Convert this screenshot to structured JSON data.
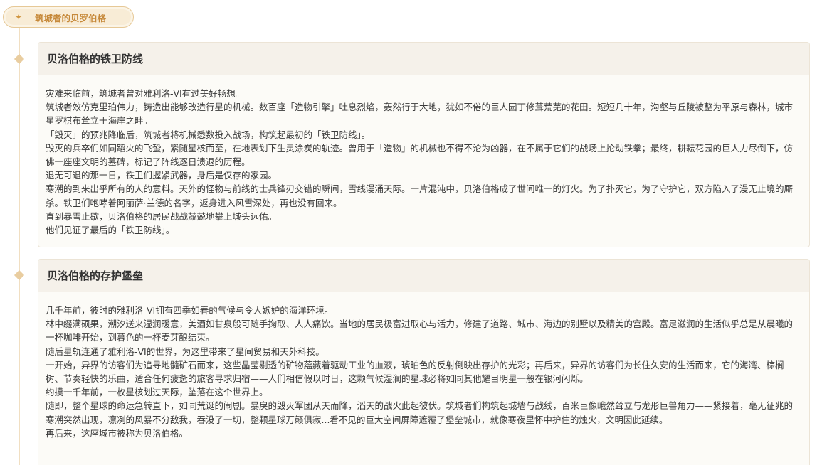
{
  "header_tag": {
    "icon": "sparkle-icon",
    "label": "筑城者的贝罗伯格"
  },
  "sections": [
    {
      "title": "贝洛伯格的铁卫防线",
      "paragraphs": [
        "灾难来临前，筑城者曾对雅利洛-VI有过美好畅想。",
        "筑城者效仿克里珀伟力，铸造出能够改造行星的机械。数百座「造物引擎」吐息烈焰，轰然行于大地，犹如不倦的巨人园丁修葺荒芜的花田。短短几十年，沟壑与丘陵被整为平原与森林，城市星罗棋布耸立于海岸之畔。",
        "「毁灭」的预兆降临后，筑城者将机械悉数投入战场，构筑起最初的「铁卫防线」。",
        "毁灭的兵卒们如同蹈火的飞蛩，紧随星核而至，在地表划下生灵涂炭的轨迹。曾用于「造物」的机械也不得不沦为凶器，在不属于它们的战场上抡动铁拳；最终，耕耘花园的巨人力尽倒下，仿佛一座座文明的墓碑，标记了阵线逐日溃退的历程。",
        "退无可退的那一日，铁卫们握紧武器，身后是仅存的家园。",
        "寒潮的到来出乎所有的人的意料。天外的怪物与前线的士兵锋刃交错的瞬间，雪线漫涌天际。一片混沌中，贝洛伯格成了世间唯一的灯火。为了扑灭它，为了守护它，双方陷入了漫无止境的厮杀。铁卫们咆哮着阿丽萨·兰德的名字，返身进入风雪深处，再也没有回来。",
        "直到暴雪止歇，贝洛伯格的居民战战兢兢地攀上城头远佑。",
        "他们见证了最后的「铁卫防线」。"
      ]
    },
    {
      "title": "贝洛伯格的存护堡垒",
      "paragraphs": [
        "几千年前，彼时的雅利洛-VI拥有四季如春的气候与令人嫉妒的海洋环境。",
        "林中缀满硕果，潮汐送来湿润暖意，美酒如甘泉般可随手掬取、人人痛饮。当地的居民极富进取心与活力，修建了道路、城市、海边的别墅以及精美的宫殿。富足滋润的生活似乎总是从晨曦的一杯咖啡开始，到暮色的一杯麦芽酿结束。",
        "随后星轨连通了雅利洛-VI的世界，为这里带来了星间贸易和天外科技。",
        "一开始，异界的访客们为追寻地髓矿石而来，这些晶莹剔透的矿物蕴藏着驱动工业的血液，琥珀色的反射倒映出存护的光彩；再后来，异界的访客们为长住久安的生活而来，它的海湾、棕榈树、节奏轻快的乐曲，适合任何疲惫的旅客寻求归宿——人们相信假以时日，这颗气候湿润的星球必将如同其他耀目明星一般在银河闪烁。",
        "约摸一千年前，一枚星核划过天际，坠落在这个世界上。",
        "随即，整个星球的命运急转直下，如同荒诞的闹剧。暴戾的毁灭军团从天而降，滔天的战火此起彼伏。筑城者们构筑起城墙与战线，百米巨像峨然耸立与龙形巨兽角力——紧接着，毫无征兆的寒潮突然出现，凛冽的风暴不分敌我，吞没了一切，整颗星球万籁俱寂...看不见的巨大空间屏障遮覆了堡垒城市，就像寒夜里怀中护住的烛火，文明因此延续。",
        "再后来，这座城市被称为贝洛伯格。"
      ]
    }
  ]
}
